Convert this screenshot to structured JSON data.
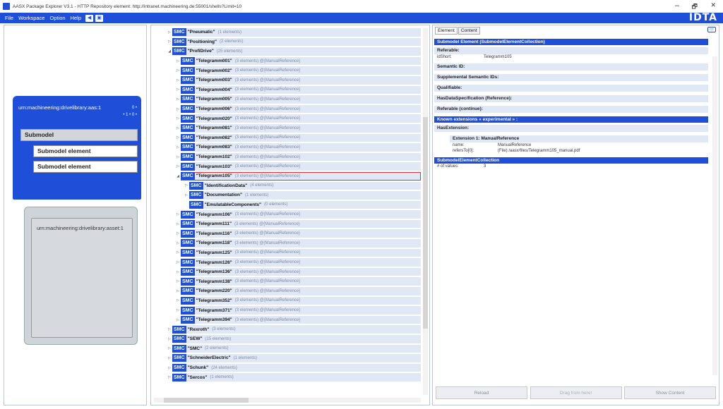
{
  "titlebar": {
    "title": "AASX Package Explorer V3.1 - HTTP Repository element: http://intranet.machineering.de:55001/shells?Limit=10",
    "minimize": "–",
    "restore": "🗗",
    "close": "✕"
  },
  "menu": {
    "file": "File",
    "workspace": "Workspace",
    "option": "Option",
    "help": "Help",
    "logo": "IDTA"
  },
  "left": {
    "aas_id": "urn:machineering:drivelibrary:aas:1",
    "dots_top": "0 •",
    "dots_bottom": "• 1 • 0 •",
    "submodel": "Submodel",
    "submodel_element_1": "Submodel element",
    "submodel_element_2": "Submodel element",
    "asset_id": "urn:machineering:drivelibrary:asset:1"
  },
  "tree": {
    "rows": [
      {
        "indent": 1,
        "tog": "▷",
        "name": "\"Pneumatic\"",
        "info": "(1 elements)"
      },
      {
        "indent": 1,
        "tog": "▷",
        "name": "\"Positioning\"",
        "info": "(2 elements)"
      },
      {
        "indent": 1,
        "tog": "◢",
        "name": "\"ProfiDrive\"",
        "info": "(25 elements)"
      },
      {
        "indent": 2,
        "tog": "▷",
        "name": "\"Telegramm001\"",
        "info": "(3 elements) @{ManualReference}"
      },
      {
        "indent": 2,
        "tog": "▷",
        "name": "\"Telegramm002\"",
        "info": "(3 elements) @{ManualReference}"
      },
      {
        "indent": 2,
        "tog": "▷",
        "name": "\"Telegramm003\"",
        "info": "(3 elements) @{ManualReference}"
      },
      {
        "indent": 2,
        "tog": "▷",
        "name": "\"Telegramm004\"",
        "info": "(3 elements) @{ManualReference}"
      },
      {
        "indent": 2,
        "tog": "▷",
        "name": "\"Telegramm005\"",
        "info": "(3 elements) @{ManualReference}"
      },
      {
        "indent": 2,
        "tog": "▷",
        "name": "\"Telegramm006\"",
        "info": "(3 elements) @{ManualReference}"
      },
      {
        "indent": 2,
        "tog": "▷",
        "name": "\"Telegramm020\"",
        "info": "(3 elements) @{ManualReference}"
      },
      {
        "indent": 2,
        "tog": "▷",
        "name": "\"Telegramm081\"",
        "info": "(3 elements) @{ManualReference}"
      },
      {
        "indent": 2,
        "tog": "▷",
        "name": "\"Telegramm082\"",
        "info": "(3 elements) @{ManualReference}"
      },
      {
        "indent": 2,
        "tog": "▷",
        "name": "\"Telegramm083\"",
        "info": "(3 elements) @{ManualReference}"
      },
      {
        "indent": 2,
        "tog": "▷",
        "name": "\"Telegramm102\"",
        "info": "(3 elements) @{ManualReference}"
      },
      {
        "indent": 2,
        "tog": "▷",
        "name": "\"Telegramm103\"",
        "info": "(3 elements) @{ManualReference}"
      },
      {
        "indent": 2,
        "tog": "◢",
        "name": "\"Telegramm105\"",
        "info": "(3 elements) @{ManualReference}",
        "selected": true
      },
      {
        "indent": 3,
        "tog": "▷",
        "name": "\"IdentificationData\"",
        "info": "(4 elements)"
      },
      {
        "indent": 3,
        "tog": "▷",
        "name": "\"Documentation\"",
        "info": "(1 elements)"
      },
      {
        "indent": 3,
        "tog": "",
        "name": "\"EmulatableComponents\"",
        "info": "(0 elements)"
      },
      {
        "indent": 2,
        "tog": "▷",
        "name": "\"Telegramm106\"",
        "info": "(3 elements) @{ManualReference}"
      },
      {
        "indent": 2,
        "tog": "▷",
        "name": "\"Telegramm111\"",
        "info": "(3 elements) @{ManualReference}"
      },
      {
        "indent": 2,
        "tog": "▷",
        "name": "\"Telegramm116\"",
        "info": "(3 elements) @{ManualReference}"
      },
      {
        "indent": 2,
        "tog": "▷",
        "name": "\"Telegramm118\"",
        "info": "(3 elements) @{ManualReference}"
      },
      {
        "indent": 2,
        "tog": "▷",
        "name": "\"Telegramm125\"",
        "info": "(3 elements) @{ManualReference}"
      },
      {
        "indent": 2,
        "tog": "▷",
        "name": "\"Telegramm126\"",
        "info": "(3 elements) @{ManualReference}"
      },
      {
        "indent": 2,
        "tog": "▷",
        "name": "\"Telegramm136\"",
        "info": "(3 elements) @{ManualReference}"
      },
      {
        "indent": 2,
        "tog": "▷",
        "name": "\"Telegramm138\"",
        "info": "(3 elements) @{ManualReference}"
      },
      {
        "indent": 2,
        "tog": "▷",
        "name": "\"Telegramm220\"",
        "info": "(3 elements) @{ManualReference}"
      },
      {
        "indent": 2,
        "tog": "▷",
        "name": "\"Telegramm352\"",
        "info": "(3 elements) @{ManualReference}"
      },
      {
        "indent": 2,
        "tog": "▷",
        "name": "\"Telegramm371\"",
        "info": "(3 elements) @{ManualReference}"
      },
      {
        "indent": 2,
        "tog": "▷",
        "name": "\"Telegramm394\"",
        "info": "(3 elements) @{ManualReference}"
      },
      {
        "indent": 1,
        "tog": "▷",
        "name": "\"Rexroth\"",
        "info": "(3 elements)"
      },
      {
        "indent": 1,
        "tog": "▷",
        "name": "\"SEW\"",
        "info": "(15 elements)"
      },
      {
        "indent": 1,
        "tog": "▷",
        "name": "\"SMC\"",
        "info": "(2 elements)"
      },
      {
        "indent": 1,
        "tog": "▷",
        "name": "\"SchneiderElectric\"",
        "info": "(1 elements)"
      },
      {
        "indent": 1,
        "tog": "▷",
        "name": "\"Schunk\"",
        "info": "(24 elements)"
      },
      {
        "indent": 1,
        "tog": "▷",
        "name": "\"Sercos\"",
        "info": "(1 elements)"
      }
    ],
    "badge": "SMC"
  },
  "right": {
    "tab_element": "Element",
    "tab_content": "Content",
    "icon_btn": "▭",
    "header": "Submodel Element (SubmodelElementCollection)",
    "referable": "Referable:",
    "idshort_key": "idShort:",
    "idshort_val": "Telegramm105",
    "semantic_id": "Semantic ID:",
    "supp_semantic": "Supplemental Semantic IDs:",
    "qualifiable": "Qualifiable:",
    "has_ds": "HasDataSpecification (Reference):",
    "referable_cont": "Referable (continue):",
    "known_ext": "Known extensions « experimental » :",
    "has_ext": "HasExtension:",
    "ext1_title": "Extension 1: ManualReference",
    "ext_name_key": "name:",
    "ext_name_val": "ManualReference",
    "ext_ref_key": "refersTo[0]:",
    "ext_ref_val": "(File) /aasx/files/Telegramm105_manual.pdf",
    "smc_header": "SubmodelElementCollection",
    "values_key": "# of values:",
    "values_val": "3",
    "btn_reload": "Reload",
    "btn_drag": "Drag from here!",
    "btn_show": "Show Content"
  }
}
